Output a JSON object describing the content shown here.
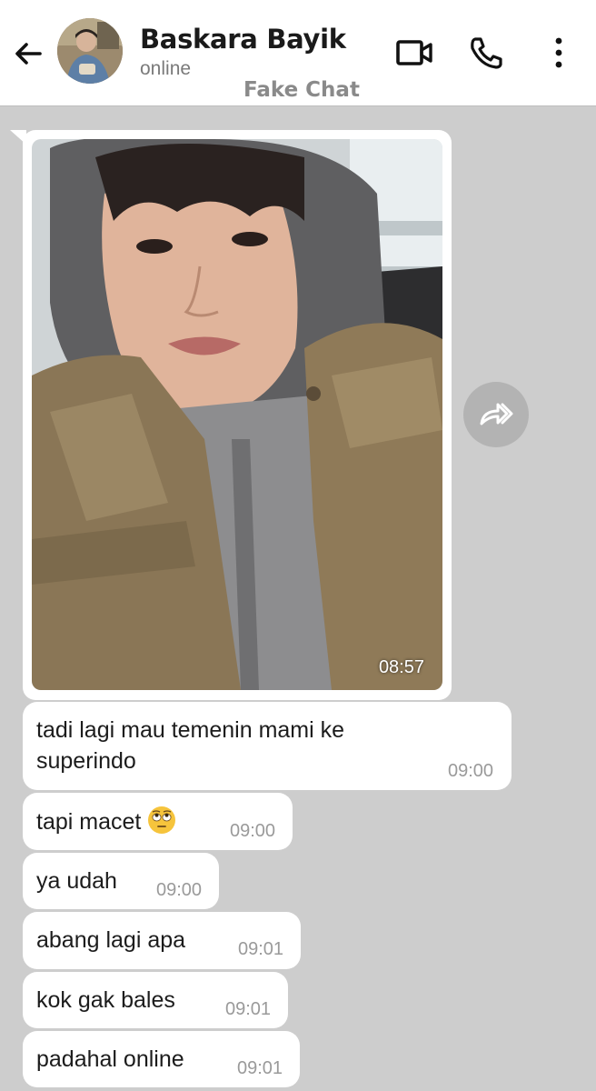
{
  "header": {
    "contact_name": "Baskara Bayik",
    "status": "online",
    "watermark": "Fake Chat",
    "icons": [
      "back-arrow-icon",
      "video-call-icon",
      "phone-call-icon",
      "more-vert-icon"
    ]
  },
  "photo_message": {
    "time": "08:57",
    "forward_icon": "forward-icon"
  },
  "messages": [
    {
      "text_line1": "tadi lagi mau temenin mami ke",
      "text_line2": "superindo",
      "time": "09:00"
    },
    {
      "text": "tapi macet",
      "emoji": "face-with-rolling-eyes",
      "time": "09:00"
    },
    {
      "text": "ya udah",
      "time": "09:00"
    },
    {
      "text": "abang lagi apa",
      "time": "09:01"
    },
    {
      "text": "kok gak bales",
      "time": "09:01"
    },
    {
      "text": "padahal online",
      "time": "09:01"
    }
  ],
  "colors": {
    "chat_background": "#cdcdcd",
    "bubble": "#ffffff",
    "header": "#ffffff"
  }
}
